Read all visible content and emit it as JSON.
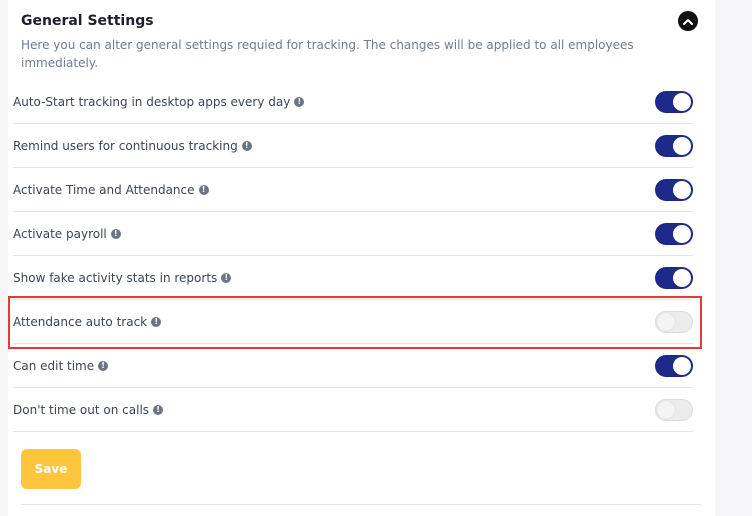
{
  "section": {
    "title": "General Settings",
    "description": "Here you can alter general settings requied for tracking. The changes will be applied to all employees immediately."
  },
  "settings": [
    {
      "label": "Auto-Start tracking in desktop apps every day",
      "enabled": true
    },
    {
      "label": "Remind users for continuous tracking",
      "enabled": true
    },
    {
      "label": "Activate Time and Attendance",
      "enabled": true
    },
    {
      "label": "Activate payroll",
      "enabled": true
    },
    {
      "label": "Show fake activity stats in reports",
      "enabled": true
    },
    {
      "label": "Attendance auto track",
      "enabled": false
    },
    {
      "label": "Can edit time",
      "enabled": true
    },
    {
      "label": "Don't time out on calls",
      "enabled": false
    }
  ],
  "actions": {
    "save_label": "Save"
  },
  "colors": {
    "toggle_on": "#1e2a8a",
    "toggle_off": "#ececec",
    "save_button": "#ffc53d",
    "highlight": "#e23b3b"
  }
}
